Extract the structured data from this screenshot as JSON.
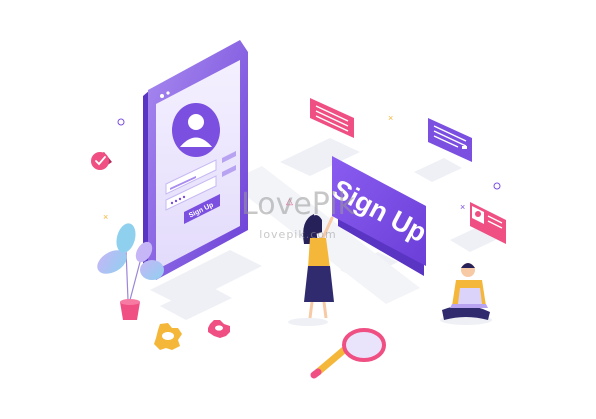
{
  "phone": {
    "button_label": "Sign Up"
  },
  "banner": {
    "label": "Sign Up"
  },
  "watermark": {
    "brand": "LovePik",
    "url": "lovepik.com"
  },
  "colors": {
    "primary_purple": "#7b4fe0",
    "light_purple": "#b9a4f2",
    "pink": "#ef4f83",
    "yellow": "#f5b73a",
    "shadow_grey": "#eceef4"
  },
  "icons": [
    "user-avatar-icon",
    "checkmark-icon",
    "magnifier-icon",
    "gear-icon",
    "laptop-icon",
    "message-bubble-icon"
  ]
}
